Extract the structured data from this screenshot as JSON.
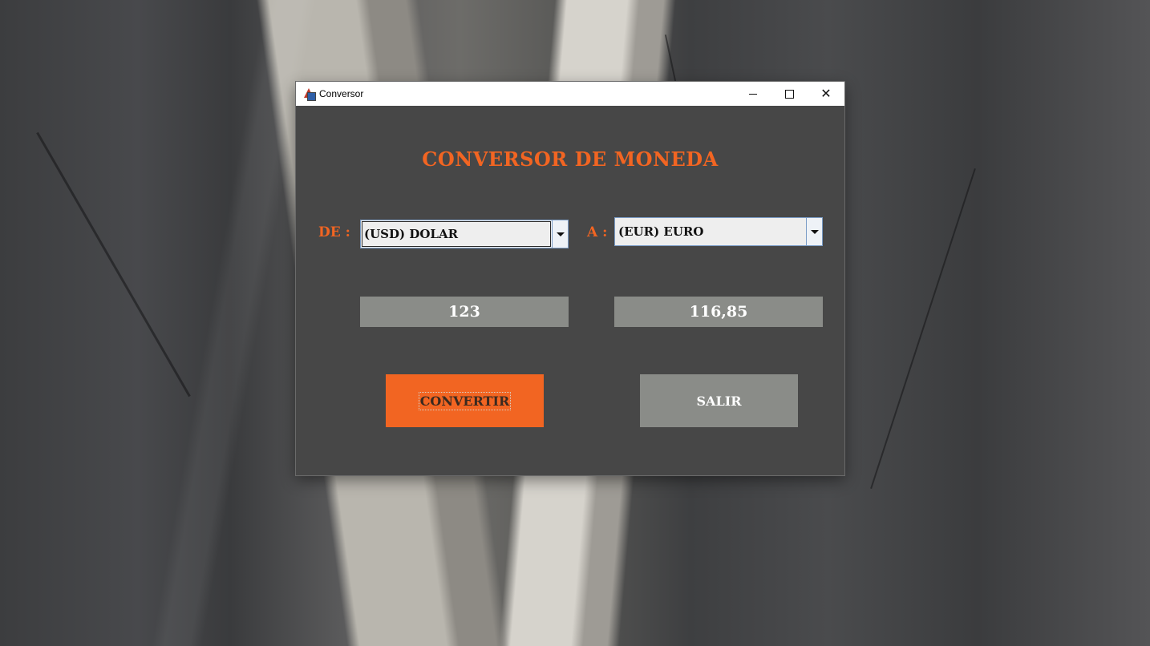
{
  "window": {
    "title": "Conversor",
    "controls": {
      "minimize": "—",
      "maximize": "□",
      "close": "✕"
    }
  },
  "main": {
    "heading": "CONVERSOR DE MONEDA",
    "from_label": "DE :",
    "to_label": "A :",
    "from_currency": "(USD) DOLAR",
    "to_currency": "(EUR) EURO",
    "amount": "123",
    "result": "116,85",
    "convert_button": "CONVERTIR",
    "exit_button": "SALIR"
  },
  "colors": {
    "accent": "#f26522",
    "panel": "#474747",
    "field": "#8a8c88"
  },
  "icons": [
    "app-java-icon",
    "minimize-icon",
    "maximize-icon",
    "close-icon",
    "chevron-down-icon"
  ]
}
